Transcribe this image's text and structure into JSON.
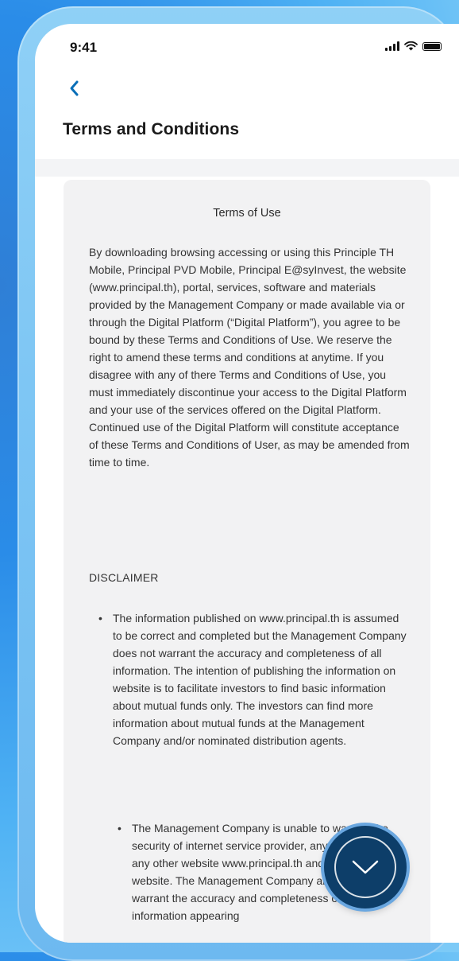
{
  "status_bar": {
    "time": "9:41"
  },
  "header": {
    "title": "Terms and Conditions"
  },
  "content": {
    "heading": "Terms of Use",
    "intro": "By downloading browsing accessing or using this Principle TH Mobile, Principal PVD Mobile, Principal E@syInvest, the website (www.principal.th), portal, services, software and materials provided by the Management Company or made available via or through the Digital Platform (“Digital Platform”), you agree to be bound by these Terms and Conditions of Use. We reserve the right to amend these terms and conditions at anytime. If you disagree with any of there Terms and Conditions of Use, you must immediately discontinue your access to the Digital Platform and your use of the services offered on the Digital Platform. Continued use of the Digital Platform will constitute acceptance of these Terms and Conditions of User, as may be amended from time to time.",
    "disclaimer_heading": "DISCLAIMER",
    "bullets": [
      "The information published on www.principal.th is assumed to be correct and completed but the Management Company does not warrant the accuracy and completeness of all information. The intention of publishing the information on website is to facilitate investors to find basic information about mutual funds only. The investors can find more information about mutual funds at the Management Company and/or nominated distribution agents.",
      "The Management Company is unable to warrant the security of internet service provider, any connection to any other website www.principal.th and any other website. The Management Company also does not warrant the accuracy and completeness of the information appearing"
    ]
  },
  "icons": {
    "back": "chevron-left-icon",
    "scroll": "chevron-down-icon",
    "signal": "signal-icon",
    "wifi": "wifi-icon",
    "battery": "battery-icon"
  },
  "colors": {
    "accent": "#0a6fb8",
    "fab": "#0d3e69",
    "card": "#f2f2f3"
  }
}
